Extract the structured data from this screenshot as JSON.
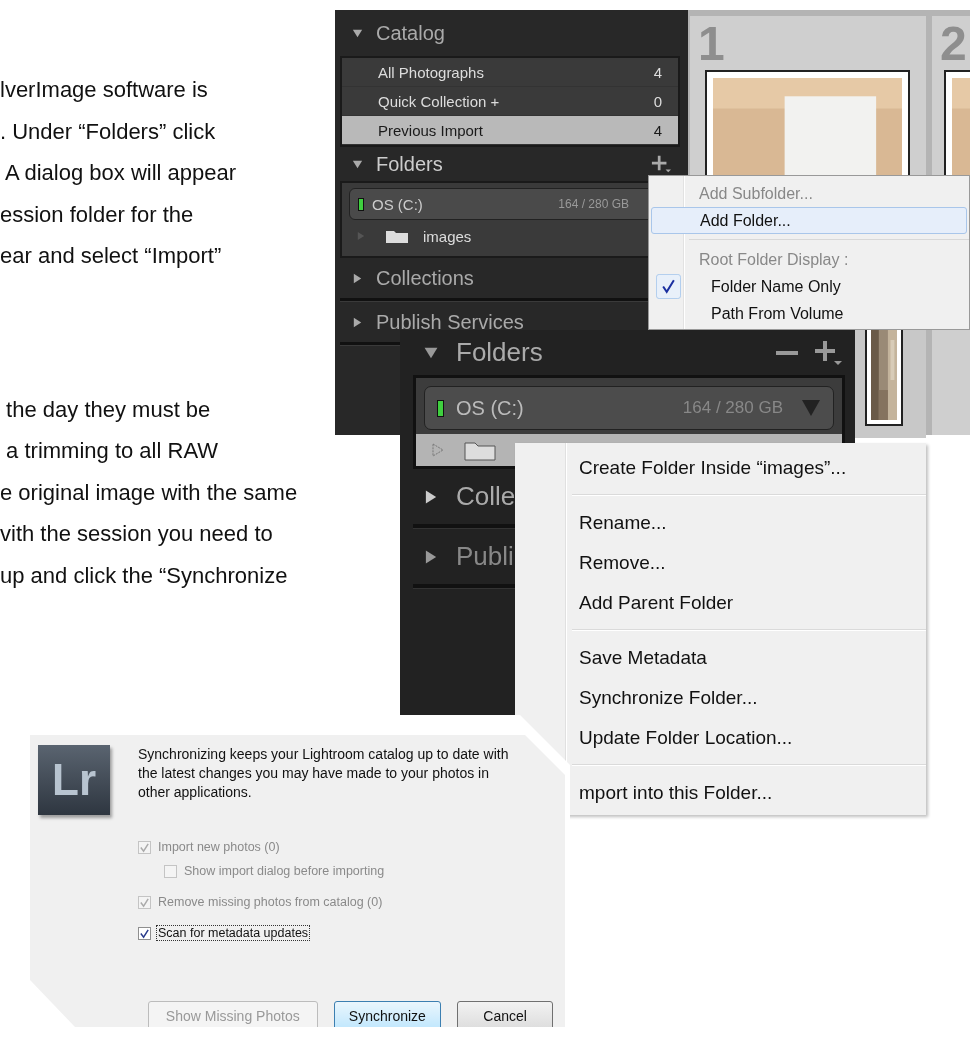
{
  "instructions": {
    "paragraphs": [
      {
        "lines": [
          "lverImage software is",
          ". Under “Folders” click",
          " A dialog box will appear",
          "ession folder for the",
          "ear and select “Import”"
        ]
      },
      {
        "lines": [
          " the day they must be",
          " a trimming to all RAW",
          "e original image with the same",
          "vith the session you need to",
          "up and click the “Synchronize"
        ]
      }
    ]
  },
  "screenshot_1": {
    "catalog": {
      "title": "Catalog",
      "expanded": true,
      "items": [
        {
          "label": "All Photographs",
          "count": "4",
          "selected": false
        },
        {
          "label": "Quick Collection +",
          "count": "0",
          "selected": false
        },
        {
          "label": "Previous Import",
          "count": "4",
          "selected": true
        }
      ]
    },
    "folders": {
      "title": "Folders",
      "expanded": true,
      "volume": {
        "name": "OS (C:)",
        "usage": "164 / 280 GB"
      },
      "items": [
        {
          "name": "images",
          "selected": false
        }
      ]
    },
    "collections": {
      "title": "Collections",
      "expanded": false
    },
    "publish_services": {
      "title": "Publish Services",
      "expanded": false
    },
    "grid": {
      "cells": [
        {
          "number": "1"
        },
        {
          "number": "2"
        }
      ]
    },
    "menu": {
      "groups": [
        [
          {
            "kind": "item",
            "label": "Add Subfolder...",
            "disabled": true,
            "selected": false,
            "checked": false
          },
          {
            "kind": "item",
            "label": "Add Folder...",
            "disabled": false,
            "selected": true,
            "checked": false
          }
        ],
        [
          {
            "kind": "header",
            "label": "Root Folder Display :",
            "disabled": true,
            "selected": false,
            "checked": false
          },
          {
            "kind": "option",
            "label": "Folder Name Only",
            "disabled": false,
            "selected": false,
            "checked": true
          },
          {
            "kind": "option",
            "label": "Path From Volume",
            "disabled": false,
            "selected": false,
            "checked": false
          }
        ]
      ]
    }
  },
  "screenshot_2": {
    "folders": {
      "title": "Folders",
      "expanded": true,
      "volume": {
        "name": "OS (C:)",
        "usage": "164 / 280 GB"
      },
      "folder": {
        "selected": true
      }
    },
    "collections": {
      "title": "Colle",
      "expanded": false
    },
    "publish_services": {
      "title": "Publi",
      "expanded": false
    },
    "menu": {
      "groups": [
        [
          {
            "label": "Create Folder Inside “images”...",
            "selected": false
          }
        ],
        [
          {
            "label": "Rename...",
            "selected": false
          },
          {
            "label": "Remove...",
            "selected": false
          },
          {
            "label": "Add Parent Folder",
            "selected": false
          }
        ],
        [
          {
            "label": "Save Metadata",
            "selected": false
          },
          {
            "label": "Synchronize Folder...",
            "selected": false
          },
          {
            "label": "Update Folder Location...",
            "selected": false
          }
        ],
        [
          {
            "label": "mport into this Folder...",
            "selected": false
          }
        ]
      ]
    }
  },
  "dialog": {
    "logo": "Lr",
    "message": "Synchronizing keeps your Lightroom catalog up to date with the latest changes you may have made to your photos in other applications.",
    "options": [
      {
        "label": "Import new photos (0)",
        "checked": true,
        "disabled": true,
        "focused": false,
        "children": [
          {
            "label": "Show import dialog before importing",
            "checked": false,
            "disabled": true,
            "focused": false
          }
        ]
      },
      {
        "label": "Remove missing photos from catalog (0)",
        "checked": true,
        "disabled": true,
        "focused": false
      },
      {
        "label": "Scan for metadata updates",
        "checked": true,
        "disabled": false,
        "focused": true
      }
    ],
    "buttons": [
      {
        "label": "Show Missing Photos",
        "disabled": true,
        "default": false
      },
      {
        "label": "Synchronize",
        "disabled": false,
        "default": true
      },
      {
        "label": "Cancel",
        "disabled": false,
        "default": false
      }
    ]
  }
}
